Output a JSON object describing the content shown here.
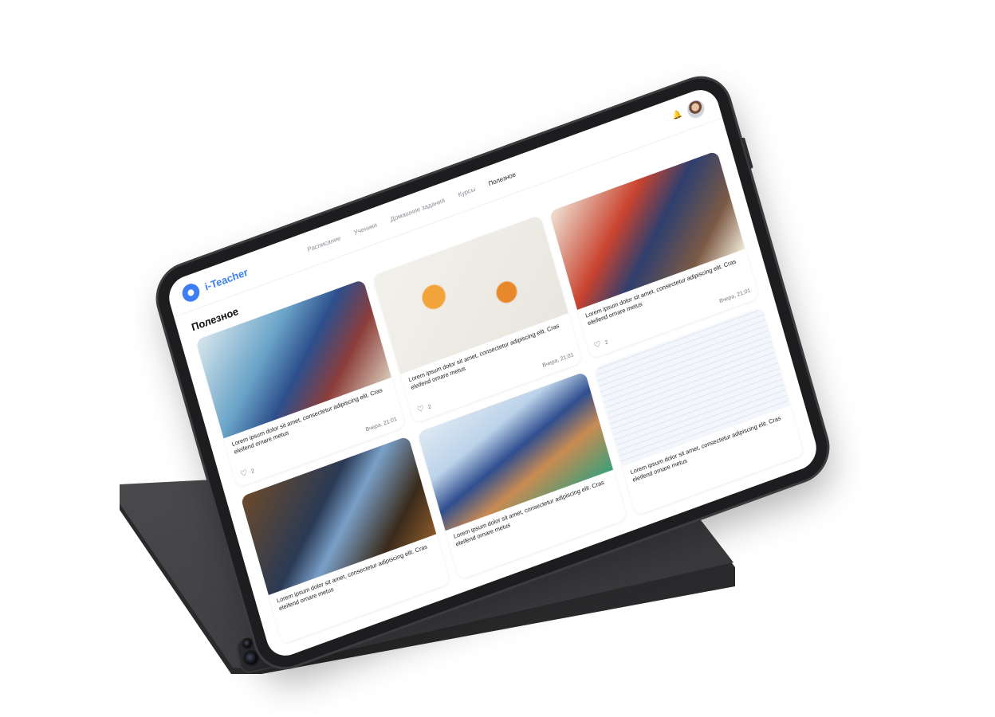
{
  "app": {
    "brand": "i-Teacher"
  },
  "nav": {
    "items": [
      {
        "label": "Расписание"
      },
      {
        "label": "Ученики"
      },
      {
        "label": "Домашние задания"
      },
      {
        "label": "Курсы"
      },
      {
        "label": "Полезное"
      }
    ],
    "active_index": 4
  },
  "page": {
    "title": "Полезное"
  },
  "cards": [
    {
      "image": "chemist",
      "text": "Lorem ipsum dolor sit amet, consectetur adipiscing elit. Cras eleifend ornare metus",
      "likes": "2",
      "date": "Вчера, 21:01"
    },
    {
      "image": "flatlay",
      "text": "Lorem ipsum dolor sit amet, consectetur adipiscing elit. Cras eleifend ornare metus",
      "likes": "2",
      "date": "Вчера, 21:01"
    },
    {
      "image": "student",
      "text": "Lorem ipsum dolor sit amet, consectetur adipiscing elit. Cras eleifend ornare metus",
      "likes": "2",
      "date": "Вчера, 21:01"
    },
    {
      "image": "robots",
      "text": "Lorem ipsum dolor sit amet, consectetur adipiscing elit. Cras eleifend ornare metus",
      "likes": "",
      "date": ""
    },
    {
      "image": "gym",
      "text": "Lorem ipsum dolor sit amet, consectetur adipiscing elit. Cras eleifend ornare metus",
      "likes": "",
      "date": ""
    },
    {
      "image": "blueprint",
      "text": "Lorem ipsum dolor sit amet, consectetur adipiscing elit. Cras eleifend ornare metus",
      "likes": "",
      "date": ""
    }
  ],
  "icons": {
    "bell": "bell-icon",
    "heart": "heart-icon",
    "avatar": "avatar"
  },
  "colors": {
    "accent": "#3d7ef5",
    "text": "#1b1d21",
    "muted": "#8a8f98"
  }
}
